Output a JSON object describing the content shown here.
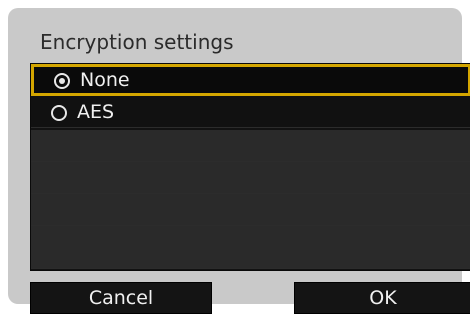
{
  "title": "Encryption settings",
  "options": [
    {
      "label": "None",
      "selected": true
    },
    {
      "label": "AES",
      "selected": false
    }
  ],
  "buttons": {
    "cancel_label": "Cancel",
    "ok_label": "OK"
  },
  "colors": {
    "selection_border": "#d4a600",
    "list_background": "#121212",
    "panel_background": "#c9c9c9"
  }
}
